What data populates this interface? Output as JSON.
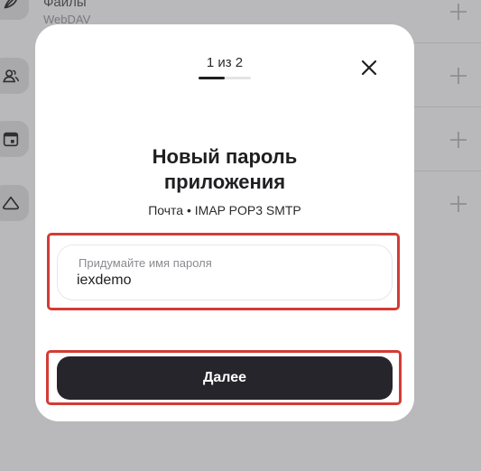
{
  "background": {
    "files_item": {
      "title": "Файлы",
      "subtitle": "WebDAV"
    },
    "side_icons": [
      "feather-icon",
      "contacts-icon",
      "calendar-icon",
      "cloud-icon"
    ]
  },
  "modal": {
    "step": "1 из 2",
    "progress": 0.5,
    "title_line1": "Новый пароль",
    "title_line2": "приложения",
    "subtitle": "Почта • IMAP POP3 SMTP",
    "field": {
      "label": "Придумайте имя пароля",
      "value": "iexdemo"
    },
    "next_label": "Далее"
  },
  "colors": {
    "highlight": "#d23c35",
    "primary": "#26252b"
  }
}
